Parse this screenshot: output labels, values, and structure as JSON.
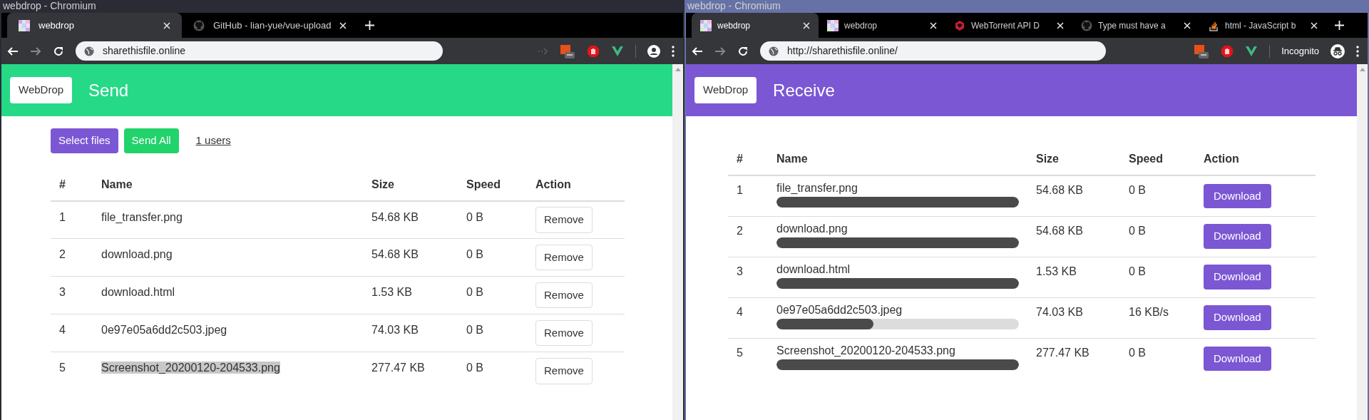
{
  "windows": [
    {
      "kind": "send",
      "title": "webdrop - Chromium",
      "tabs": [
        {
          "label": "webdrop",
          "kind": "webdrop",
          "selected": true
        },
        {
          "label": "GitHub - lian-yue/vue-upload",
          "kind": "github",
          "selected": false
        }
      ],
      "url": "sharethisfile.online",
      "header": {
        "logo": "WebDrop",
        "title": "Send"
      },
      "actions": {
        "select": "Select files",
        "send": "Send All",
        "users": "1 users"
      },
      "columns": [
        "#",
        "Name",
        "Size",
        "Speed",
        "Action"
      ],
      "rows": [
        {
          "index": "1",
          "name": "file_transfer.png",
          "size": "54.68 KB",
          "speed": "0 B",
          "action": "Remove",
          "text_selected": false
        },
        {
          "index": "2",
          "name": "download.png",
          "size": "54.68 KB",
          "speed": "0 B",
          "action": "Remove",
          "text_selected": false
        },
        {
          "index": "3",
          "name": "download.html",
          "size": "1.53 KB",
          "speed": "0 B",
          "action": "Remove",
          "text_selected": false
        },
        {
          "index": "4",
          "name": "0e97e05a6dd2c503.jpeg",
          "size": "74.03 KB",
          "speed": "0 B",
          "action": "Remove",
          "text_selected": false
        },
        {
          "index": "5",
          "name": "Screenshot_20200120-204533.png",
          "size": "277.47 KB",
          "speed": "0 B",
          "action": "Remove",
          "text_selected": true
        }
      ]
    },
    {
      "kind": "receive",
      "title": "webdrop - Chromium",
      "tabs": [
        {
          "label": "webdrop",
          "kind": "webdrop",
          "selected": true
        },
        {
          "label": "webdrop",
          "kind": "webdrop",
          "selected": false
        },
        {
          "label": "WebTorrent API D",
          "kind": "webtorrent",
          "selected": false
        },
        {
          "label": "Type must have a",
          "kind": "github",
          "selected": false
        },
        {
          "label": "html - JavaScript b",
          "kind": "stack",
          "selected": false
        }
      ],
      "url": "http://sharethisfile.online/",
      "incognito": "Incognito",
      "header": {
        "logo": "WebDrop",
        "title": "Receive"
      },
      "columns": [
        "#",
        "Name",
        "Size",
        "Speed",
        "Action"
      ],
      "rows": [
        {
          "index": "1",
          "name": "file_transfer.png",
          "level": 1,
          "size": "54.68 KB",
          "speed": "0 B",
          "action": "Download"
        },
        {
          "index": "2",
          "name": "download.png",
          "level": 1,
          "size": "54.68 KB",
          "speed": "0 B",
          "action": "Download"
        },
        {
          "index": "3",
          "name": "download.html",
          "level": 1,
          "size": "1.53 KB",
          "speed": "0 B",
          "action": "Download"
        },
        {
          "index": "4",
          "name": "0e97e05a6dd2c503.jpeg",
          "level": 0.4,
          "size": "74.03 KB",
          "speed": "16 KB/s",
          "action": "Download"
        },
        {
          "index": "5",
          "name": "Screenshot_20200120-204533.png",
          "level": 1,
          "size": "277.47 KB",
          "speed": "0 B",
          "action": "Download"
        }
      ]
    }
  ]
}
